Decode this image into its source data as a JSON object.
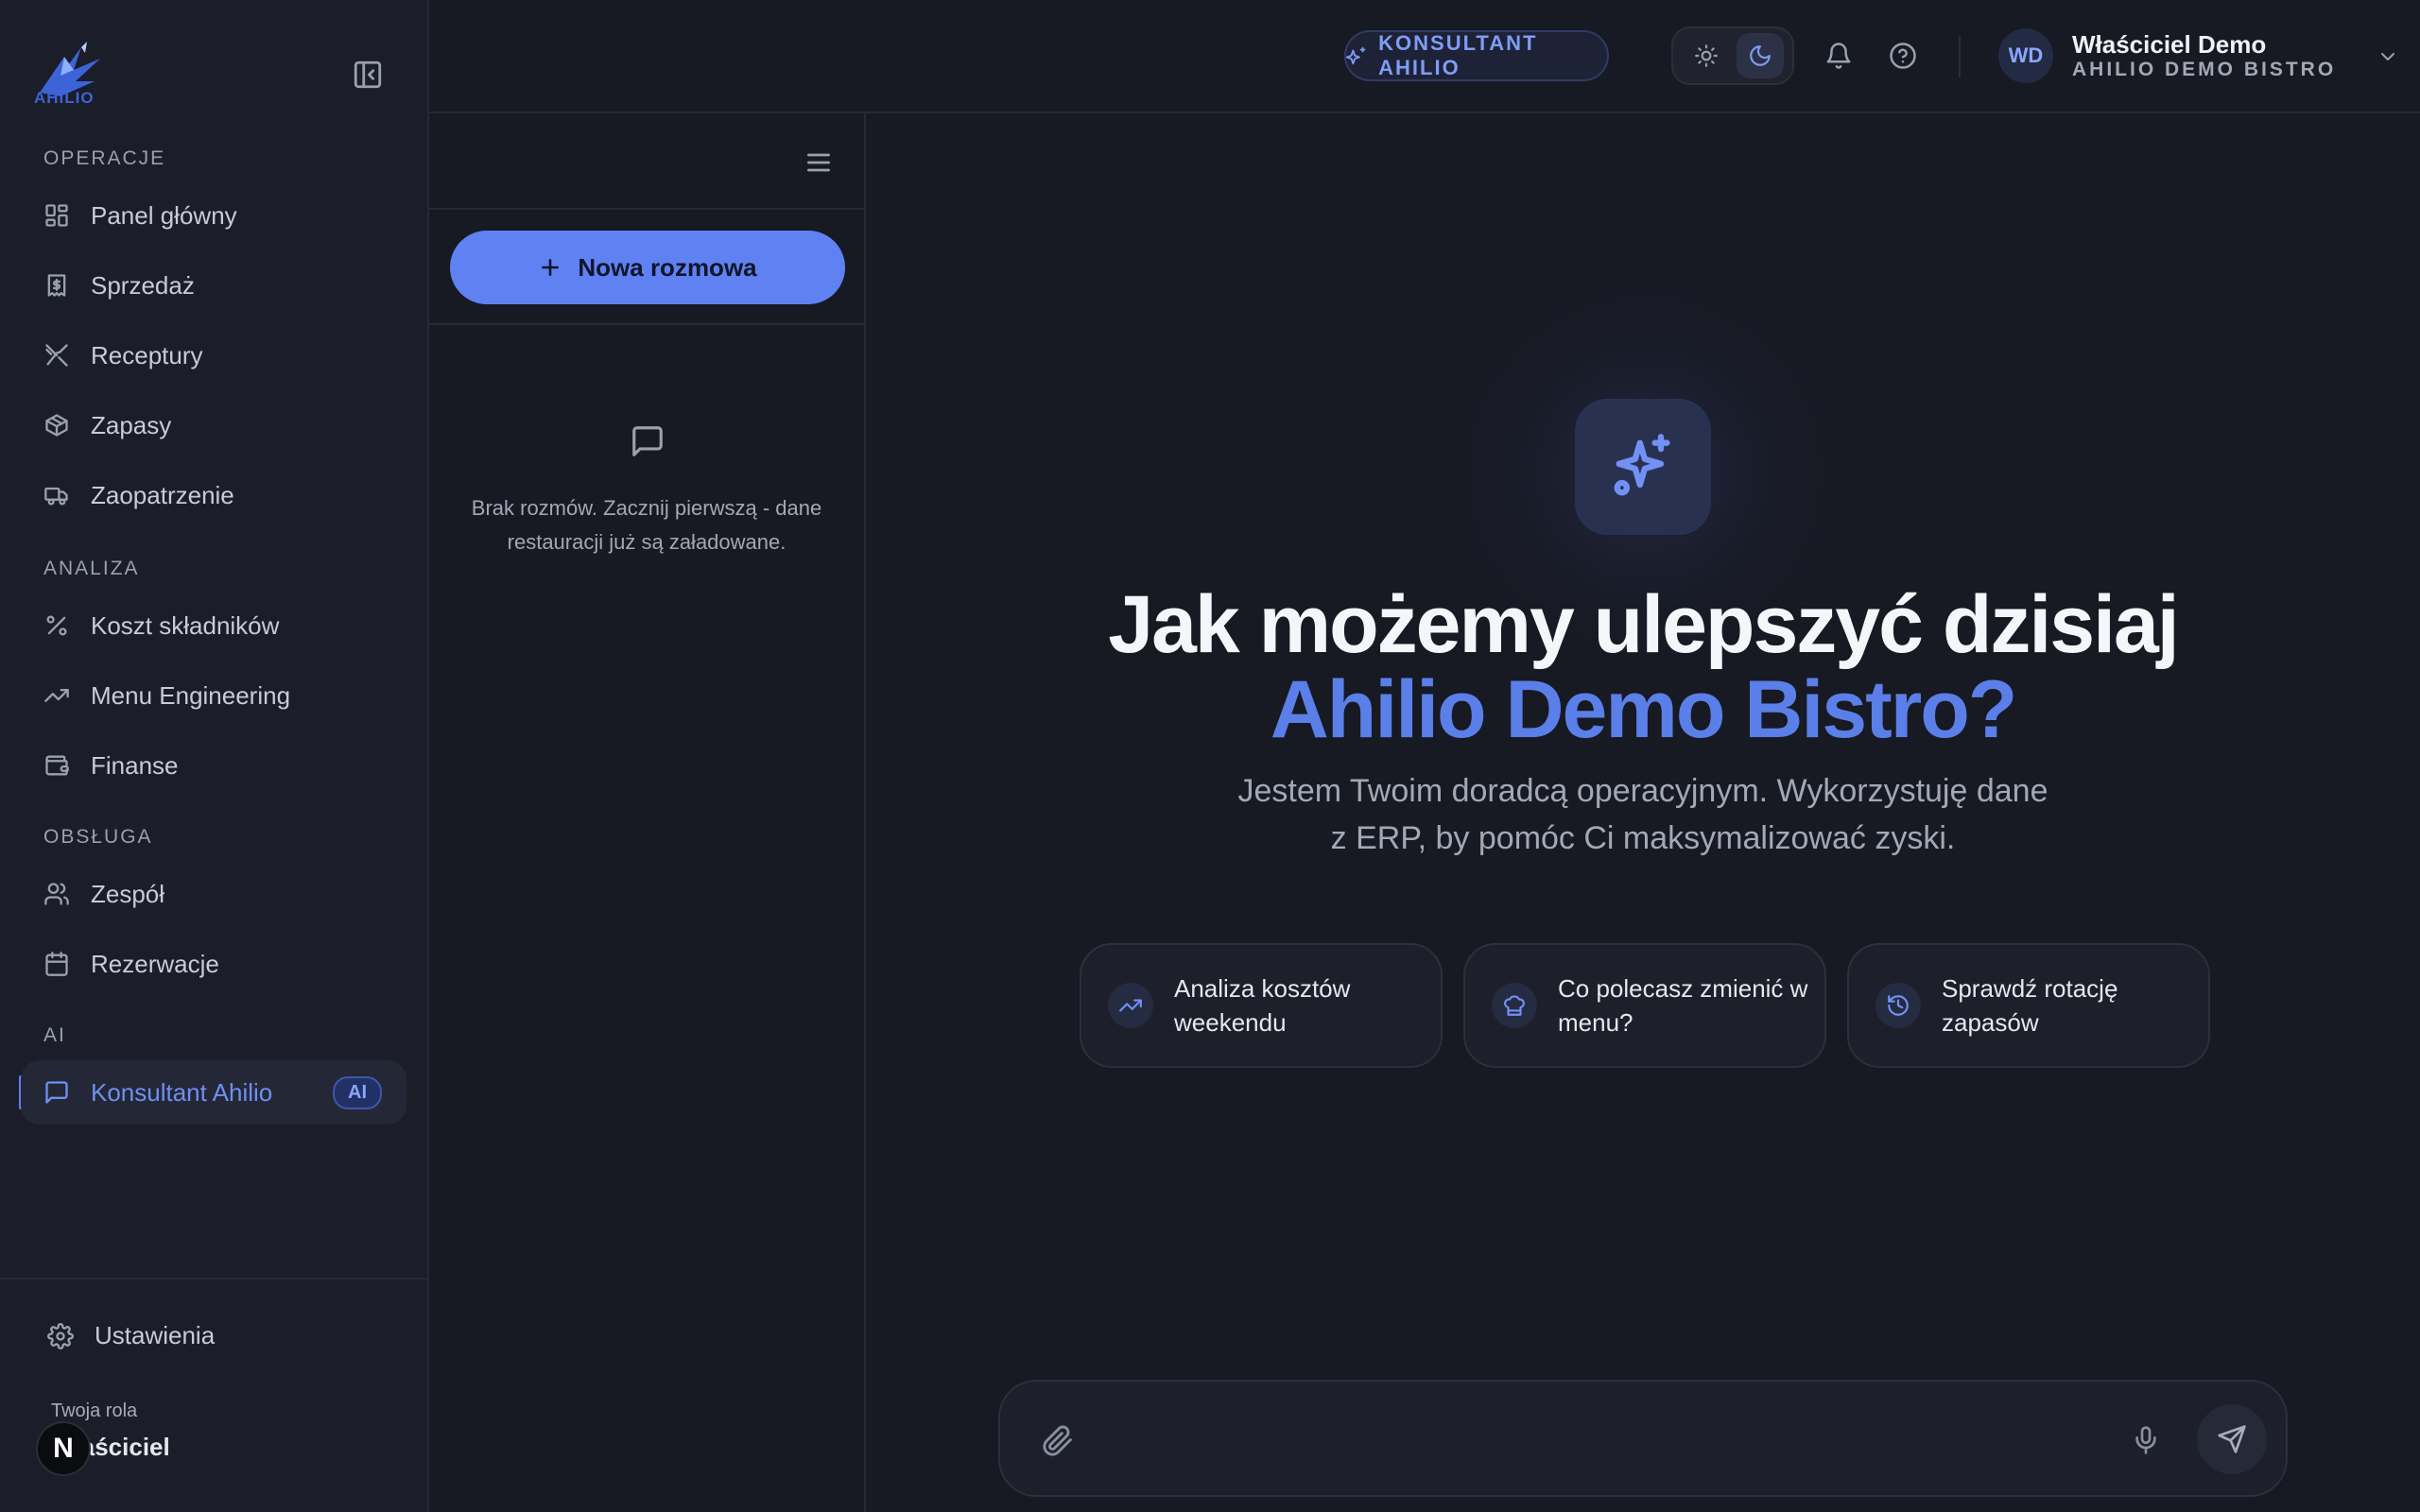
{
  "app": {
    "logo_text": "AHILIO",
    "accent_color": "#5f81f2"
  },
  "sidebar": {
    "sections": [
      {
        "label": "OPERACJE"
      },
      {
        "label": "ANALIZA"
      },
      {
        "label": "OBSŁUGA"
      },
      {
        "label": "AI"
      }
    ],
    "items": [
      {
        "label": "Panel główny",
        "icon": "dashboard-grid-icon"
      },
      {
        "label": "Sprzedaż",
        "icon": "receipt-icon"
      },
      {
        "label": "Receptury",
        "icon": "utensils-icon"
      },
      {
        "label": "Zapasy",
        "icon": "package-icon"
      },
      {
        "label": "Zaopatrzenie",
        "icon": "truck-icon"
      },
      {
        "label": "Koszt składników",
        "icon": "percent-icon"
      },
      {
        "label": "Menu Engineering",
        "icon": "trending-up-icon"
      },
      {
        "label": "Finanse",
        "icon": "wallet-icon"
      },
      {
        "label": "Zespół",
        "icon": "users-icon"
      },
      {
        "label": "Rezerwacje",
        "icon": "calendar-icon"
      },
      {
        "label": "Konsultant Ahilio",
        "icon": "chat-icon",
        "badge": "AI",
        "active": true
      }
    ],
    "settings_label": "Ustawienia",
    "role_label": "Twoja rola",
    "role_value": "Właściciel",
    "dev_badge": "N"
  },
  "header": {
    "consultant_button": "KONSULTANT AHILIO",
    "theme": "dark",
    "user": {
      "initials": "WD",
      "name": "Właściciel Demo",
      "organization": "AHILIO DEMO BISTRO"
    }
  },
  "conversations": {
    "new_button": "Nowa rozmowa",
    "empty_text": "Brak rozmów. Zacznij pierwszą - dane restauracji już są załadowane."
  },
  "main": {
    "title_line1": "Jak możemy ulepszyć dzisiaj",
    "title_line2": "Ahilio Demo Bistro?",
    "subtitle": "Jestem Twoim doradcą operacyjnym. Wykorzystuję dane z ERP, by pomóc Ci maksymalizować zyski.",
    "suggestions": [
      {
        "label": "Analiza kosztów weekendu",
        "icon": "trending-up-icon"
      },
      {
        "label": "Co polecasz zmienić w menu?",
        "icon": "chef-hat-icon"
      },
      {
        "label": "Sprawdź rotację zapasów",
        "icon": "history-icon"
      }
    ],
    "composer": {
      "value": "",
      "placeholder": ""
    }
  }
}
